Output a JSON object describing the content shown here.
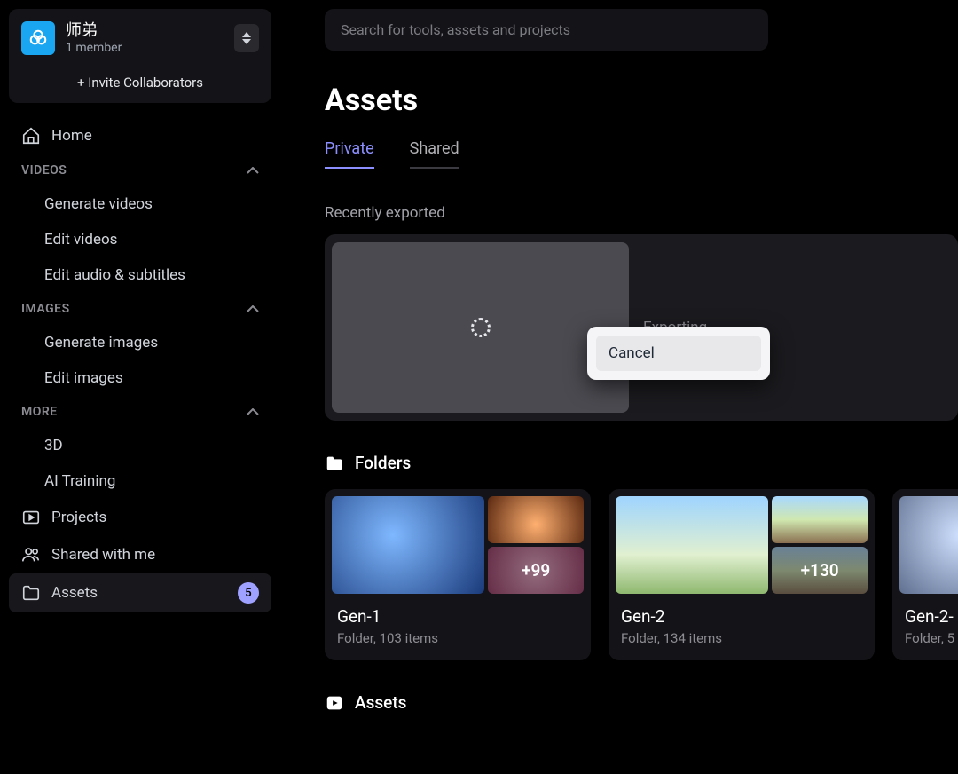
{
  "workspace": {
    "name": "师弟",
    "members": "1 member",
    "invite": "+ Invite Collaborators"
  },
  "search": {
    "placeholder": "Search for tools, assets and projects"
  },
  "nav": {
    "home": "Home",
    "sections": {
      "videos": {
        "label": "VIDEOS",
        "items": [
          "Generate videos",
          "Edit videos",
          "Edit audio & subtitles"
        ]
      },
      "images": {
        "label": "IMAGES",
        "items": [
          "Generate images",
          "Edit images"
        ]
      },
      "more": {
        "label": "MORE",
        "items": [
          "3D",
          "AI Training"
        ]
      }
    },
    "projects": "Projects",
    "shared": "Shared with me",
    "assets": "Assets",
    "assets_badge": "5"
  },
  "page": {
    "title": "Assets",
    "tabs": {
      "private": "Private",
      "shared": "Shared"
    },
    "recently_exported": "Recently exported",
    "exporting": "Exporting",
    "folders_label": "Folders",
    "assets_label": "Assets"
  },
  "popup": {
    "cancel": "Cancel"
  },
  "folders": [
    {
      "name": "Gen-1",
      "sub": "Folder, 103 items",
      "count": "+99"
    },
    {
      "name": "Gen-2",
      "sub": "Folder, 134 items",
      "count": "+130"
    },
    {
      "name": "Gen-2-",
      "sub": "Folder, 5",
      "count": ""
    }
  ]
}
